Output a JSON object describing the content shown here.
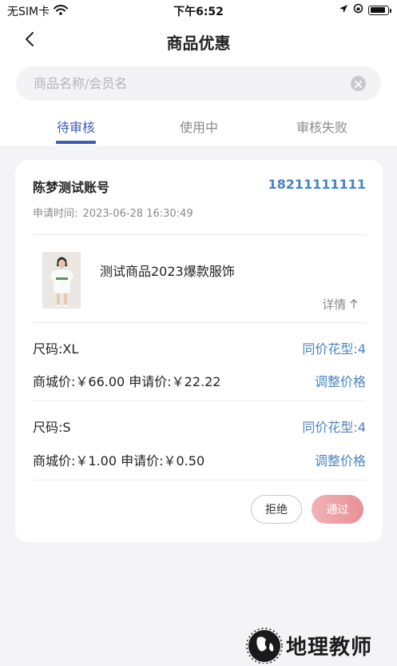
{
  "status_bar": {
    "carrier": "无SIM卡",
    "time": "下午6:52"
  },
  "header": {
    "title": "商品优惠"
  },
  "search": {
    "placeholder": "商品名称/会员名",
    "value": ""
  },
  "tabs": [
    {
      "label": "待审核",
      "active": true
    },
    {
      "label": "使用中",
      "active": false
    },
    {
      "label": "审核失败",
      "active": false
    }
  ],
  "card": {
    "member_name": "陈梦测试账号",
    "phone": "18211111111",
    "apply_time_label": "申请时间:",
    "apply_time": "2023-06-28 16:30:49",
    "product_name": "测试商品2023爆款服饰",
    "detail_label": "详情",
    "skus": [
      {
        "size": "尺码:XL",
        "same_price_pattern": "同价花型:4",
        "prices": "商城价:￥66.00 申请价:￥22.22",
        "adjust_label": "调整价格"
      },
      {
        "size": "尺码:S",
        "same_price_pattern": "同价花型:4",
        "prices": "商城价:￥1.00 申请价:￥0.50",
        "adjust_label": "调整价格"
      }
    ],
    "reject_label": "拒绝",
    "approve_label": "通过"
  },
  "watermark": {
    "text": "地理教师"
  },
  "colors": {
    "accent_blue": "#3d5fb8",
    "link_blue": "#4a83c3",
    "approve_gradient_start": "#f1b3b6",
    "approve_gradient_end": "#e88f95",
    "page_bg": "#f4f4f6"
  },
  "icons": [
    "wifi-icon",
    "location-arrow-icon",
    "rotation-lock-icon",
    "battery-icon",
    "back-chevron-icon",
    "clear-icon",
    "arrow-up-icon"
  ]
}
